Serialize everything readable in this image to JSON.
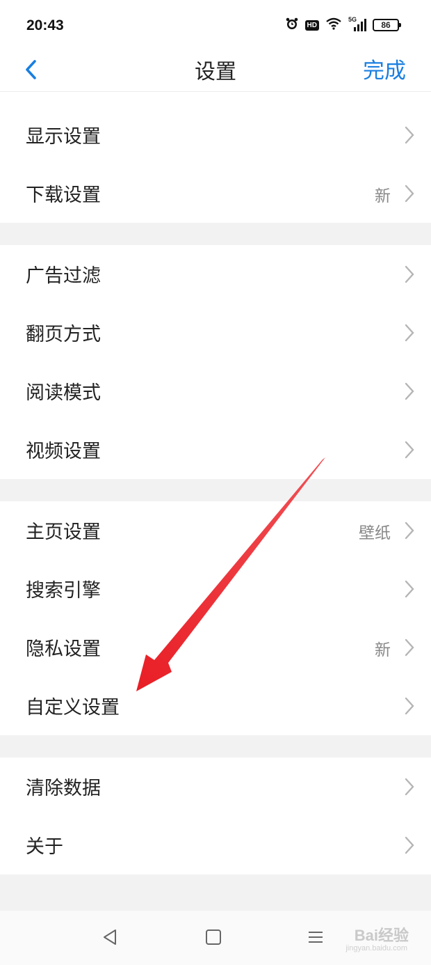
{
  "status_bar": {
    "time": "20:43",
    "hd": "HD",
    "network": "5G",
    "battery": "86"
  },
  "header": {
    "title": "设置",
    "done_label": "完成",
    "accent_color": "#1a7fe0"
  },
  "groups": [
    {
      "items": [
        {
          "label": "显示设置",
          "value": ""
        },
        {
          "label": "下载设置",
          "value": "新"
        }
      ]
    },
    {
      "items": [
        {
          "label": "广告过滤",
          "value": ""
        },
        {
          "label": "翻页方式",
          "value": ""
        },
        {
          "label": "阅读模式",
          "value": ""
        },
        {
          "label": "视频设置",
          "value": ""
        }
      ]
    },
    {
      "items": [
        {
          "label": "主页设置",
          "value": "壁纸"
        },
        {
          "label": "搜索引擎",
          "value": ""
        },
        {
          "label": "隐私设置",
          "value": "新"
        },
        {
          "label": "自定义设置",
          "value": ""
        }
      ]
    },
    {
      "items": [
        {
          "label": "清除数据",
          "value": ""
        },
        {
          "label": "关于",
          "value": ""
        }
      ]
    }
  ],
  "annotation": {
    "color": "#e8141c"
  },
  "watermark": {
    "text": "Bai经验",
    "sub": "jingyan.baidu.com"
  }
}
